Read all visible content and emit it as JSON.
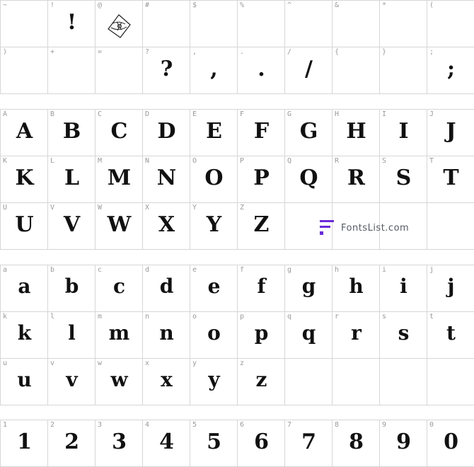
{
  "symbols": [
    {
      "label": "~",
      "glyph": ""
    },
    {
      "label": "!",
      "glyph": "!"
    },
    {
      "label": "@",
      "glyph": "",
      "icon": "rose-ornament-icon"
    },
    {
      "label": "#",
      "glyph": ""
    },
    {
      "label": "$",
      "glyph": ""
    },
    {
      "label": "%",
      "glyph": ""
    },
    {
      "label": "^",
      "glyph": ""
    },
    {
      "label": "&",
      "glyph": ""
    },
    {
      "label": "*",
      "glyph": ""
    },
    {
      "label": "(",
      "glyph": ""
    },
    {
      "label": ")",
      "glyph": ""
    },
    {
      "label": "+",
      "glyph": ""
    },
    {
      "label": "=",
      "glyph": ""
    },
    {
      "label": "?",
      "glyph": "?"
    },
    {
      "label": ",",
      "glyph": ","
    },
    {
      "label": ".",
      "glyph": "."
    },
    {
      "label": "/",
      "glyph": "/"
    },
    {
      "label": "{",
      "glyph": ""
    },
    {
      "label": "}",
      "glyph": ""
    },
    {
      "label": ";",
      "glyph": ";"
    }
  ],
  "uppercase": [
    {
      "label": "A",
      "glyph": "A"
    },
    {
      "label": "B",
      "glyph": "B"
    },
    {
      "label": "C",
      "glyph": "C"
    },
    {
      "label": "D",
      "glyph": "D"
    },
    {
      "label": "E",
      "glyph": "E"
    },
    {
      "label": "F",
      "glyph": "F"
    },
    {
      "label": "G",
      "glyph": "G"
    },
    {
      "label": "H",
      "glyph": "H"
    },
    {
      "label": "I",
      "glyph": "I"
    },
    {
      "label": "J",
      "glyph": "J"
    },
    {
      "label": "K",
      "glyph": "K"
    },
    {
      "label": "L",
      "glyph": "L"
    },
    {
      "label": "M",
      "glyph": "M"
    },
    {
      "label": "N",
      "glyph": "N"
    },
    {
      "label": "O",
      "glyph": "O"
    },
    {
      "label": "P",
      "glyph": "P"
    },
    {
      "label": "Q",
      "glyph": "Q"
    },
    {
      "label": "R",
      "glyph": "R"
    },
    {
      "label": "S",
      "glyph": "S"
    },
    {
      "label": "T",
      "glyph": "T"
    },
    {
      "label": "U",
      "glyph": "U"
    },
    {
      "label": "V",
      "glyph": "V"
    },
    {
      "label": "W",
      "glyph": "W"
    },
    {
      "label": "X",
      "glyph": "X"
    },
    {
      "label": "Y",
      "glyph": "Y"
    },
    {
      "label": "Z",
      "glyph": "Z"
    },
    {
      "label": "",
      "glyph": ""
    },
    {
      "label": "",
      "glyph": ""
    },
    {
      "label": "",
      "glyph": ""
    },
    {
      "label": "",
      "glyph": ""
    }
  ],
  "lowercase": [
    {
      "label": "a",
      "glyph": "a"
    },
    {
      "label": "b",
      "glyph": "b"
    },
    {
      "label": "c",
      "glyph": "c"
    },
    {
      "label": "d",
      "glyph": "d"
    },
    {
      "label": "e",
      "glyph": "e"
    },
    {
      "label": "f",
      "glyph": "f"
    },
    {
      "label": "g",
      "glyph": "g"
    },
    {
      "label": "h",
      "glyph": "h"
    },
    {
      "label": "i",
      "glyph": "i"
    },
    {
      "label": "j",
      "glyph": "j"
    },
    {
      "label": "k",
      "glyph": "k"
    },
    {
      "label": "l",
      "glyph": "l"
    },
    {
      "label": "m",
      "glyph": "m"
    },
    {
      "label": "n",
      "glyph": "n"
    },
    {
      "label": "o",
      "glyph": "o"
    },
    {
      "label": "p",
      "glyph": "p"
    },
    {
      "label": "q",
      "glyph": "q"
    },
    {
      "label": "r",
      "glyph": "r"
    },
    {
      "label": "s",
      "glyph": "s"
    },
    {
      "label": "t",
      "glyph": "t"
    },
    {
      "label": "u",
      "glyph": "u"
    },
    {
      "label": "v",
      "glyph": "v"
    },
    {
      "label": "w",
      "glyph": "w"
    },
    {
      "label": "x",
      "glyph": "x"
    },
    {
      "label": "y",
      "glyph": "y"
    },
    {
      "label": "z",
      "glyph": "z"
    },
    {
      "label": "",
      "glyph": ""
    },
    {
      "label": "",
      "glyph": ""
    },
    {
      "label": "",
      "glyph": ""
    },
    {
      "label": "",
      "glyph": ""
    }
  ],
  "digits": [
    {
      "label": "1",
      "glyph": "1"
    },
    {
      "label": "2",
      "glyph": "2"
    },
    {
      "label": "3",
      "glyph": "3"
    },
    {
      "label": "4",
      "glyph": "4"
    },
    {
      "label": "5",
      "glyph": "5"
    },
    {
      "label": "6",
      "glyph": "6"
    },
    {
      "label": "7",
      "glyph": "7"
    },
    {
      "label": "8",
      "glyph": "8"
    },
    {
      "label": "9",
      "glyph": "9"
    },
    {
      "label": "0",
      "glyph": "0"
    }
  ],
  "watermark": {
    "text": "FontsList.com",
    "icon": "fontslist-logo-icon",
    "color": "#6b2bd9"
  },
  "colors": {
    "grid": "#d6d6d6",
    "label": "#9a9a9a",
    "glyph": "#111111"
  }
}
